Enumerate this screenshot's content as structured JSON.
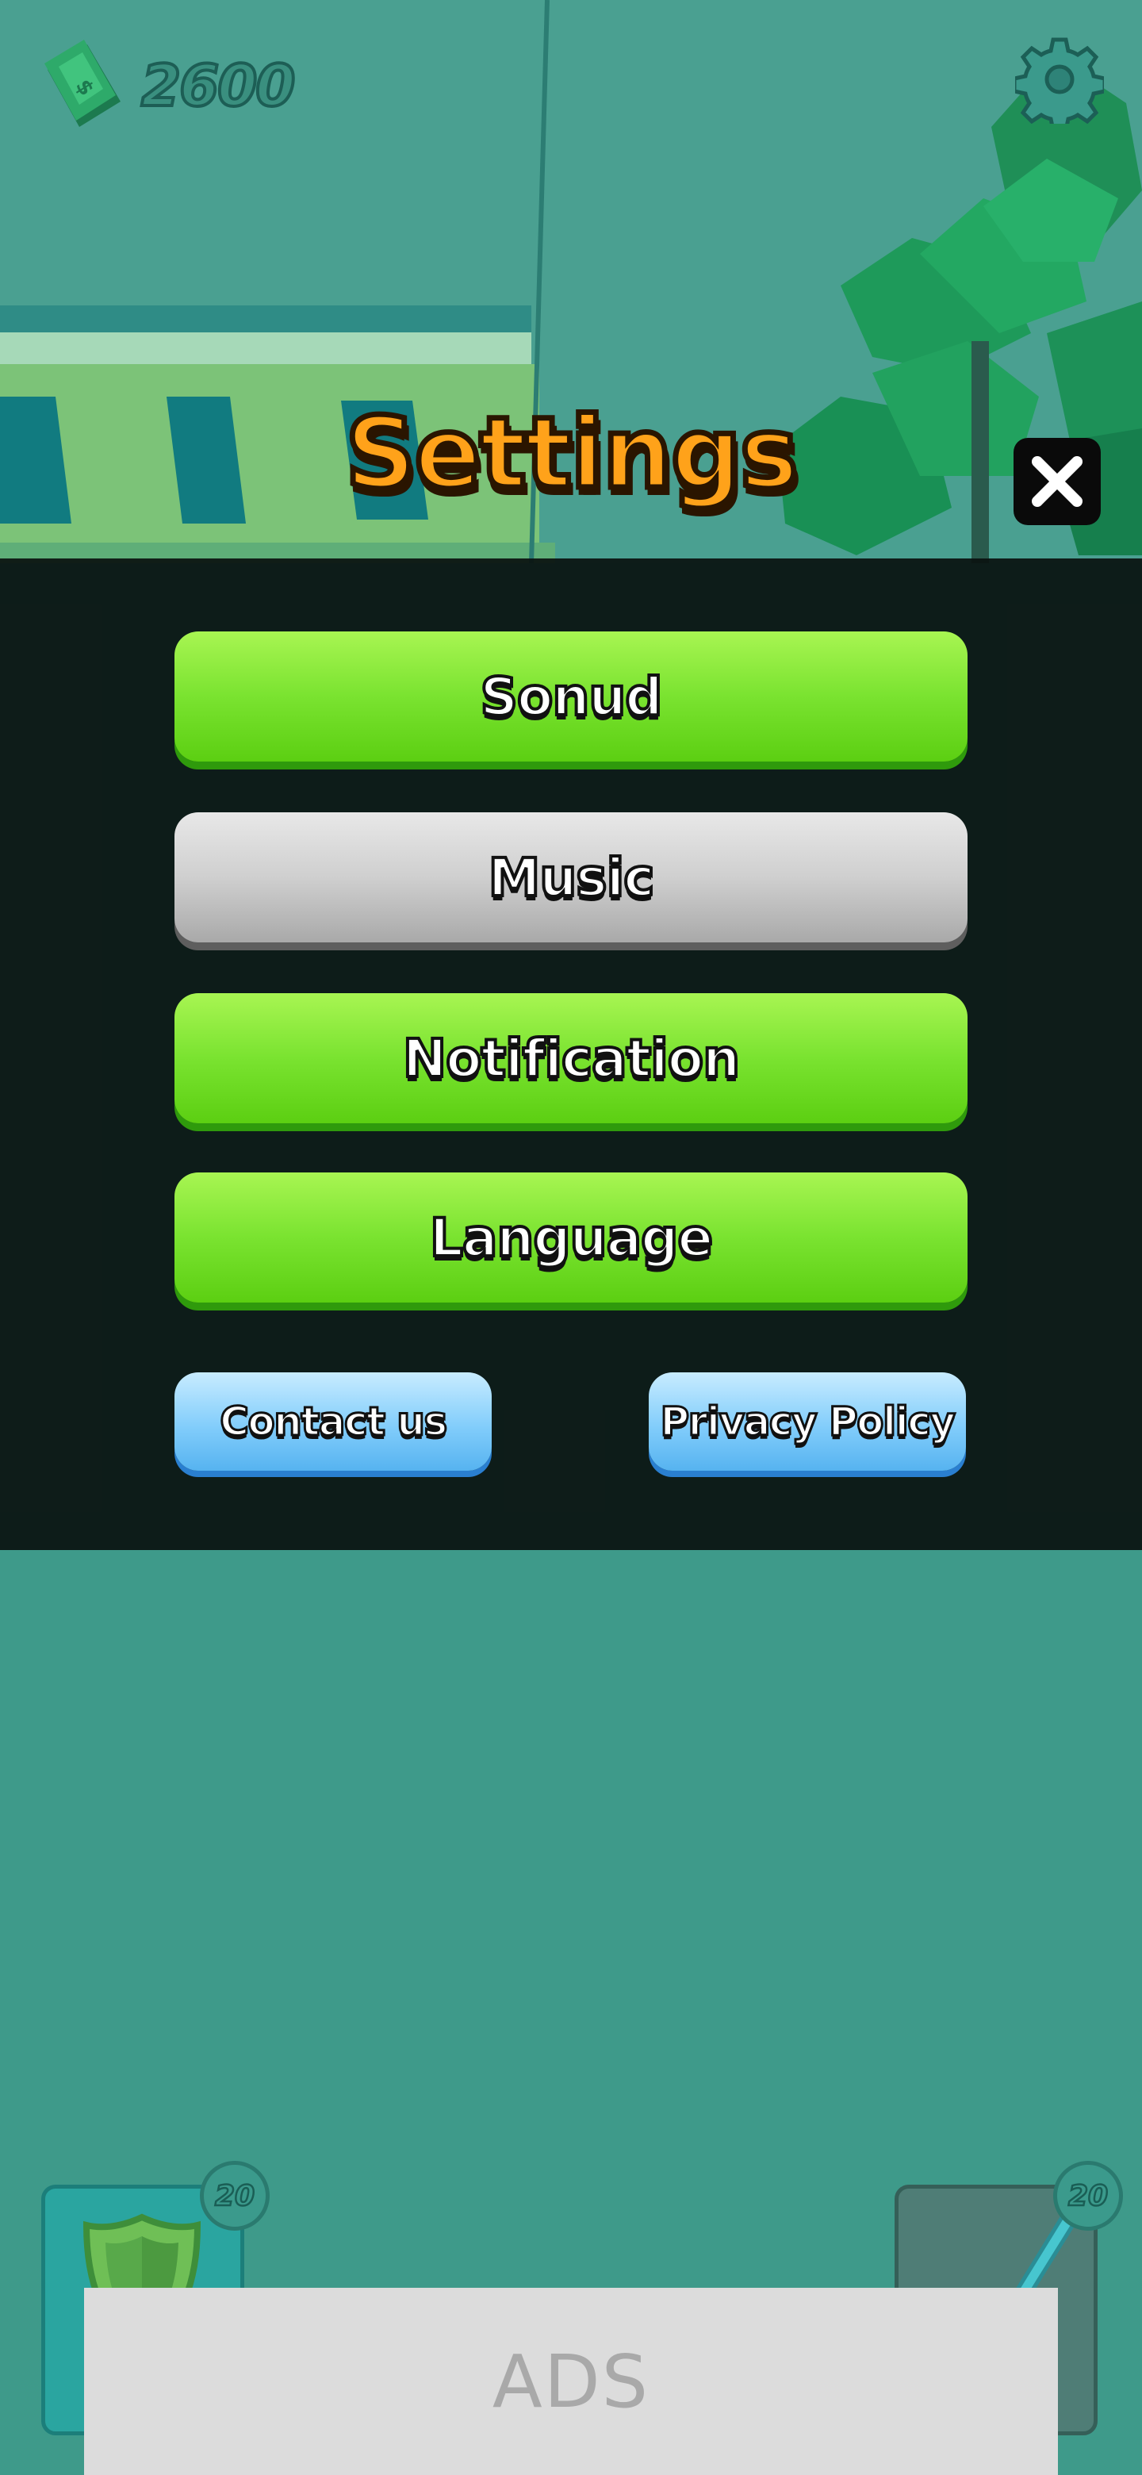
{
  "hud": {
    "currency_icon": "cash-icon",
    "currency_amount": "2600",
    "settings_icon": "gear-icon"
  },
  "settings_dialog": {
    "title": "Settings",
    "close_icon": "close-icon",
    "buttons": [
      {
        "label": "Sonud",
        "state": "on",
        "color": "#7ae330"
      },
      {
        "label": "Music",
        "state": "off",
        "color": "#cfcfcf"
      },
      {
        "label": "Notification",
        "state": "on",
        "color": "#7ae330"
      },
      {
        "label": "Language",
        "state": "on",
        "color": "#7ae330"
      }
    ],
    "contact_label": "Contact us",
    "privacy_label": "Privacy Policy",
    "secondary_color": "#82cdfb"
  },
  "bottom_items": [
    {
      "icon": "shield-icon",
      "count": "20"
    },
    {
      "icon": "sword-icon",
      "count": "20"
    }
  ],
  "ads": {
    "label": "ADS"
  },
  "colors": {
    "background": "#3e9a8a",
    "title_orange": "#ffa21a",
    "overlay": "#0a1210"
  }
}
